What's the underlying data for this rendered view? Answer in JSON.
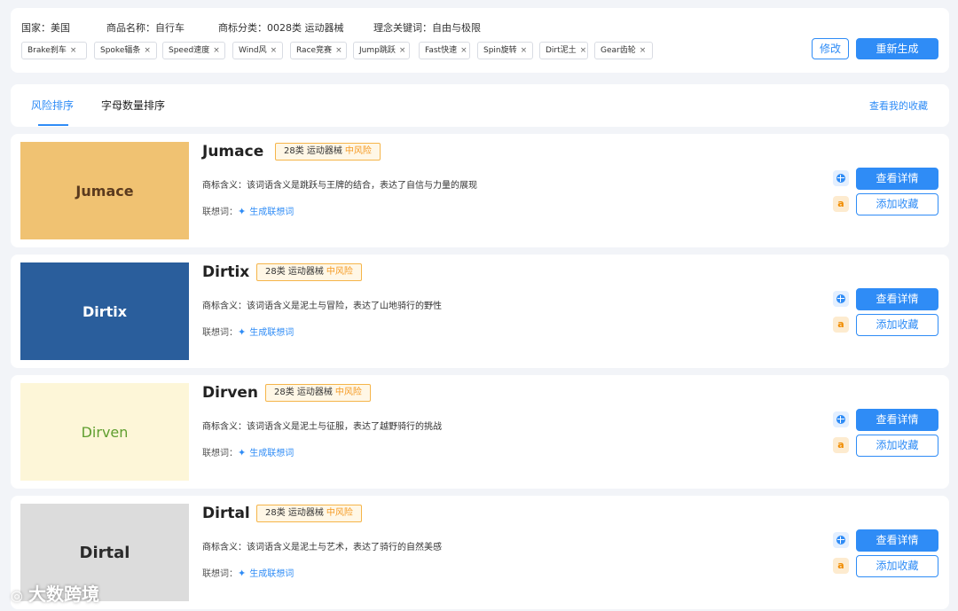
{
  "filters": {
    "country": "国家：美国",
    "product": "商品名称：自行车",
    "category": "商标分类：0028类 运动器械",
    "keyword": "理念关键词：自由与极限",
    "tags": [
      "Brake刹车",
      "Spoke辐条",
      "Speed速度",
      "Wind风",
      "Race竞赛",
      "Jump跳跃",
      "Fast快速",
      "Spin旋转",
      "Dirt泥土",
      "Gear齿轮"
    ],
    "tag_remove_glyph": "×",
    "edit_label": "修改",
    "regenerate_label": "重新生成"
  },
  "tabs": {
    "items": [
      "风险排序",
      "字母数量排序"
    ],
    "active_index": 0,
    "favorites_link": "查看我的收藏"
  },
  "cards": [
    {
      "name": "Jumace",
      "logo_text": "Jumace",
      "logo_bg": "#f0c272",
      "logo_color": "#5a3a1e",
      "category": "28类 运动器械",
      "risk": "中风险",
      "meaning": "商标含义：该词语含义是跳跃与王牌的结合，表达了自信与力量的展现",
      "assoc_label": "联想词：",
      "assoc_action": "生成联想词",
      "detail_label": "查看详情",
      "fav_label": "添加收藏"
    },
    {
      "name": "Dirtix",
      "logo_text": "Dirtix",
      "logo_bg": "#2a5e9c",
      "logo_color": "#ffffff",
      "category": "28类 运动器械",
      "risk": "中风险",
      "meaning": "商标含义：该词语含义是泥土与冒险，表达了山地骑行的野性",
      "assoc_label": "联想词：",
      "assoc_action": "生成联想词",
      "detail_label": "查看详情",
      "fav_label": "添加收藏"
    },
    {
      "name": "Dirven",
      "logo_text": "Dirven",
      "logo_bg": "#fdf6d8",
      "logo_color": "#5f9e2f",
      "category": "28类 运动器械",
      "risk": "中风险",
      "meaning": "商标含义：该词语含义是泥土与征服，表达了越野骑行的挑战",
      "assoc_label": "联想词：",
      "assoc_action": "生成联想词",
      "detail_label": "查看详情",
      "fav_label": "添加收藏"
    },
    {
      "name": "Dirtal",
      "logo_text": "Dirtal",
      "logo_bg": "#dcdcdc",
      "logo_color": "#2b2b2b",
      "category": "28类 运动器械",
      "risk": "中风险",
      "meaning": "商标含义：该词语含义是泥土与艺术，表达了骑行的自然美感",
      "assoc_label": "联想词：",
      "assoc_action": "生成联想词",
      "detail_label": "查看详情",
      "fav_label": "添加收藏"
    }
  ],
  "colors": {
    "accent": "#2f8cf6",
    "risk_medium": "#f59a23"
  },
  "watermark": "大数跨境"
}
